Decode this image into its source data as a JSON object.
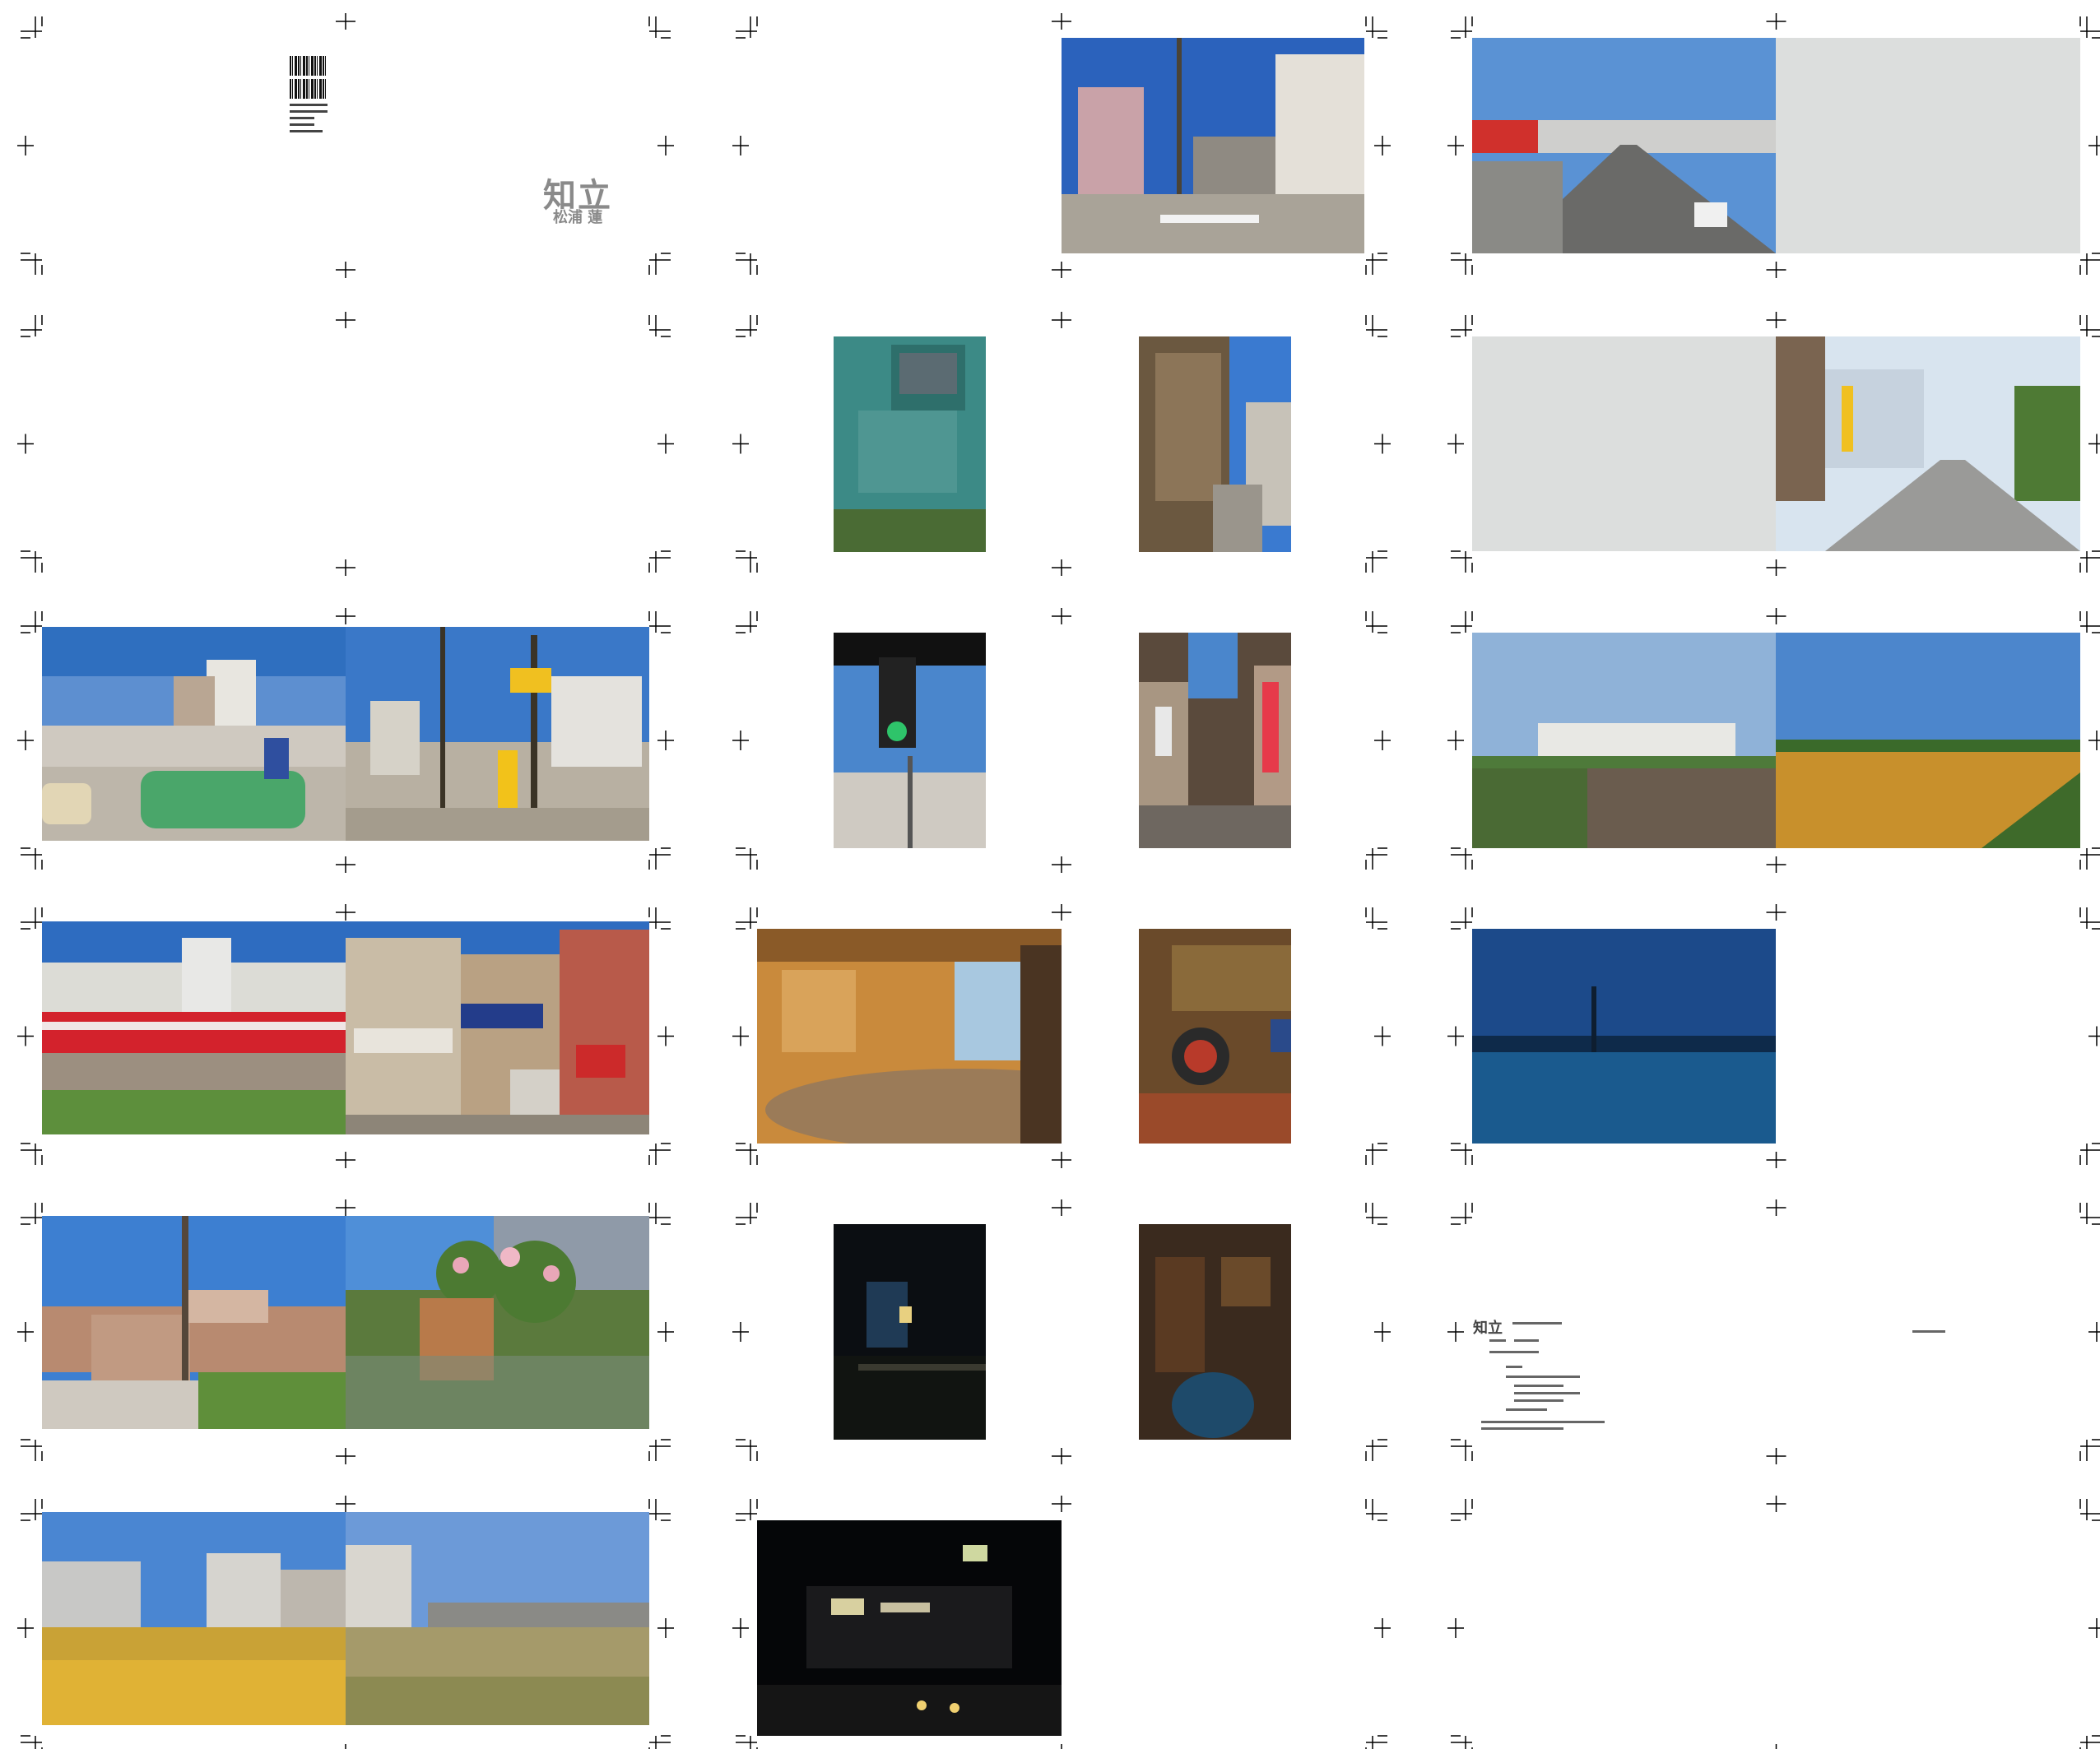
{
  "cover": {
    "title": "知立",
    "author": "松浦 蓮"
  },
  "colophon": {
    "title": "知立"
  }
}
